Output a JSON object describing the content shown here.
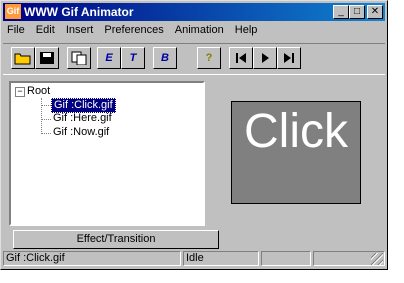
{
  "window": {
    "title": "WWW Gif Animator",
    "app_icon_text": "Gif"
  },
  "title_buttons": {
    "minimize": "_",
    "maximize": "□",
    "close": "✕"
  },
  "menu": [
    {
      "label": "File"
    },
    {
      "label": "Edit"
    },
    {
      "label": "Insert"
    },
    {
      "label": "Preferences"
    },
    {
      "label": "Animation"
    },
    {
      "label": "Help"
    }
  ],
  "toolbar": {
    "open_icon": "folder-open-icon",
    "save_icon": "floppy-save-icon",
    "copy_icon": "copy-icon",
    "e_label": "E",
    "t_label": "T",
    "b_label": "B",
    "help_label": "?",
    "first_icon": "skip-first-icon",
    "play_icon": "play-icon",
    "last_icon": "skip-last-icon"
  },
  "tree": {
    "root": "Root",
    "items": [
      "Gif :Click.gif",
      "Gif :Here.gif",
      "Gif :Now.gif"
    ]
  },
  "effect_button": "Effect/Transition",
  "preview_text": "Click",
  "status": {
    "file": "Gif :Click.gif",
    "state": "Idle"
  }
}
